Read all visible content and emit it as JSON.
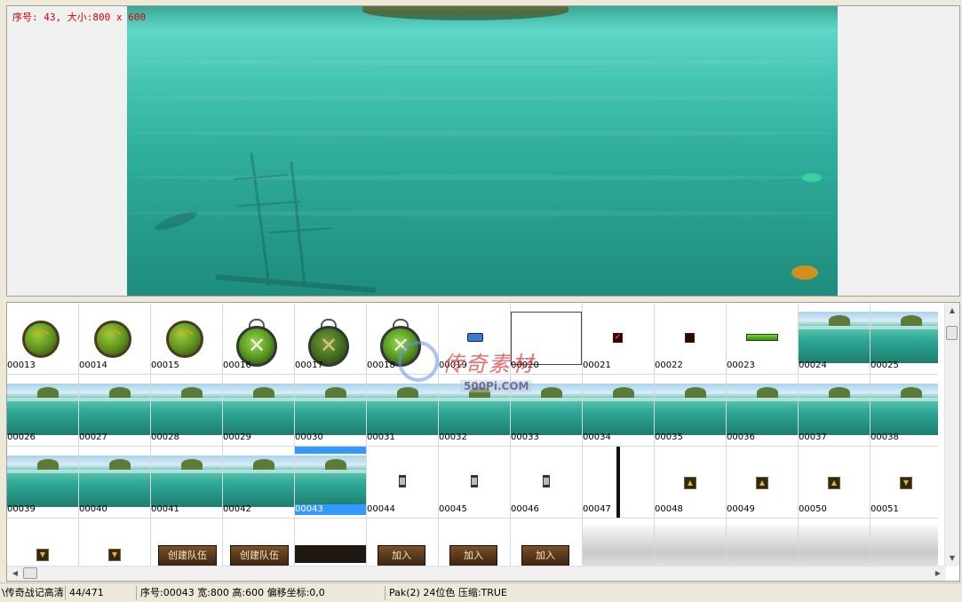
{
  "preview": {
    "info": "序号: 43, 大小:800 x 600"
  },
  "grid": {
    "cells": [
      {
        "label": "00013",
        "kind": "bow-orb-icon"
      },
      {
        "label": "00014",
        "kind": "bow-orb-icon"
      },
      {
        "label": "00015",
        "kind": "bow-orb-icon"
      },
      {
        "label": "00016",
        "kind": "close-orb-icon"
      },
      {
        "label": "00017",
        "kind": "close-orb-dim-icon"
      },
      {
        "label": "00018",
        "kind": "close-orb-icon"
      },
      {
        "label": "00019",
        "kind": "blue-bar-icon"
      },
      {
        "label": "00020",
        "kind": "outline-frame"
      },
      {
        "label": "00021",
        "kind": "checkbox-checked-icon"
      },
      {
        "label": "00022",
        "kind": "checkbox-empty-icon"
      },
      {
        "label": "00023",
        "kind": "green-bar-icon"
      },
      {
        "label": "00024",
        "kind": "sea-thumbnail"
      },
      {
        "label": "00025",
        "kind": "sea-thumbnail"
      },
      {
        "label": "00026",
        "kind": "sea-thumbnail"
      },
      {
        "label": "00027",
        "kind": "sea-thumbnail"
      },
      {
        "label": "00028",
        "kind": "sea-thumbnail"
      },
      {
        "label": "00029",
        "kind": "sea-thumbnail"
      },
      {
        "label": "00030",
        "kind": "sea-thumbnail"
      },
      {
        "label": "00031",
        "kind": "sea-thumbnail"
      },
      {
        "label": "00032",
        "kind": "sea-thumbnail"
      },
      {
        "label": "00033",
        "kind": "sea-thumbnail"
      },
      {
        "label": "00034",
        "kind": "sea-thumbnail"
      },
      {
        "label": "00035",
        "kind": "sea-thumbnail"
      },
      {
        "label": "00036",
        "kind": "sea-thumbnail"
      },
      {
        "label": "00037",
        "kind": "sea-thumbnail"
      },
      {
        "label": "00038",
        "kind": "sea-thumbnail"
      },
      {
        "label": "00039",
        "kind": "sea-thumbnail"
      },
      {
        "label": "00040",
        "kind": "sea-thumbnail"
      },
      {
        "label": "00041",
        "kind": "sea-thumbnail"
      },
      {
        "label": "00042",
        "kind": "sea-thumbnail"
      },
      {
        "label": "00043",
        "kind": "sea-thumbnail",
        "selected": true
      },
      {
        "label": "00044",
        "kind": "scroll-handle-icon"
      },
      {
        "label": "00045",
        "kind": "scroll-handle-icon"
      },
      {
        "label": "00046",
        "kind": "scroll-handle-icon"
      },
      {
        "label": "00047",
        "kind": "vertical-line"
      },
      {
        "label": "00048",
        "kind": "arrow-up-icon"
      },
      {
        "label": "00049",
        "kind": "arrow-up-icon"
      },
      {
        "label": "00050",
        "kind": "arrow-up-icon"
      },
      {
        "label": "00051",
        "kind": "arrow-down-icon"
      },
      {
        "label": "",
        "kind": "arrow-down-icon"
      },
      {
        "label": "",
        "kind": "arrow-down-icon"
      },
      {
        "label": "",
        "kind": "button-image",
        "text": "创建队伍"
      },
      {
        "label": "",
        "kind": "button-image",
        "text": "创建队伍"
      },
      {
        "label": "",
        "kind": "dark-bar"
      },
      {
        "label": "",
        "kind": "button-image-small",
        "text": "加入"
      },
      {
        "label": "",
        "kind": "button-image-small",
        "text": "加入"
      },
      {
        "label": "",
        "kind": "button-image-small",
        "text": "加入"
      },
      {
        "label": "",
        "kind": "cloud-thumbnail"
      },
      {
        "label": "",
        "kind": "cloud-thumbnail"
      },
      {
        "label": "",
        "kind": "cloud-thumbnail"
      },
      {
        "label": "",
        "kind": "cloud-thumbnail"
      },
      {
        "label": "",
        "kind": "cloud-thumbnail"
      }
    ]
  },
  "watermark": {
    "text": "传奇素材",
    "site": "500Pi.COM"
  },
  "status": {
    "file": "\\传奇战记高清",
    "count": "44/471",
    "detail": "序号:00043 宽:800 高:600 偏移坐标:0,0",
    "format": "Pak(2) 24位色 压缩:TRUE"
  },
  "colors": {
    "selection": "#3399ff",
    "info_text": "#d40000",
    "sea": "#2fae9e"
  }
}
